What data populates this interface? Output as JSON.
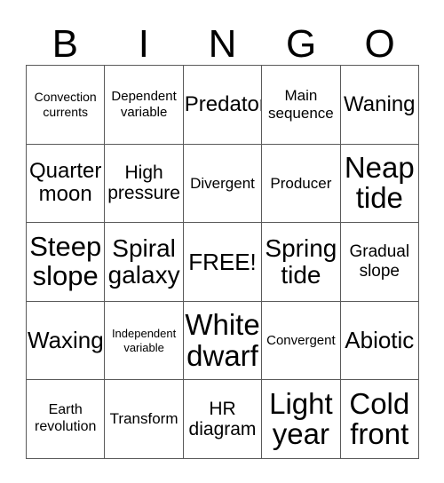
{
  "card": {
    "title_letters": [
      "B",
      "I",
      "N",
      "G",
      "O"
    ],
    "background_color": "#ffffff",
    "border_color": "#5a5a5a",
    "text_color": "#000000",
    "columns": 5,
    "rows": 5,
    "free_space_label": "FREE!",
    "cells": [
      [
        {
          "text": "Convection currents",
          "size": "fs-14"
        },
        {
          "text": "Dependent variable",
          "size": "fs-15"
        },
        {
          "text": "Predator",
          "size": "fs-24"
        },
        {
          "text": "Main sequence",
          "size": "fs-17"
        },
        {
          "text": "Waning",
          "size": "fs-24"
        }
      ],
      [
        {
          "text": "Quarter moon",
          "size": "fs-24"
        },
        {
          "text": "High pressure",
          "size": "fs-21"
        },
        {
          "text": "Divergent",
          "size": "fs-17"
        },
        {
          "text": "Producer",
          "size": "fs-17"
        },
        {
          "text": "Neap tide",
          "size": "fs-33"
        }
      ],
      [
        {
          "text": "Steep slope",
          "size": "fs-31"
        },
        {
          "text": "Spiral galaxy",
          "size": "fs-28"
        },
        {
          "text": "FREE!",
          "size": "fs-26"
        },
        {
          "text": "Spring tide",
          "size": "fs-28"
        },
        {
          "text": "Gradual slope",
          "size": "fs-19"
        }
      ],
      [
        {
          "text": "Waxing",
          "size": "fs-26"
        },
        {
          "text": "Independent variable",
          "size": "fs-13"
        },
        {
          "text": "White dwarf",
          "size": "fs-33"
        },
        {
          "text": "Convergent",
          "size": "fs-15"
        },
        {
          "text": "Abiotic",
          "size": "fs-26"
        }
      ],
      [
        {
          "text": "Earth revolution",
          "size": "fs-16"
        },
        {
          "text": "Transform",
          "size": "fs-17"
        },
        {
          "text": "HR diagram",
          "size": "fs-21"
        },
        {
          "text": "Light year",
          "size": "fs-33"
        },
        {
          "text": "Cold front",
          "size": "fs-33"
        }
      ]
    ]
  }
}
